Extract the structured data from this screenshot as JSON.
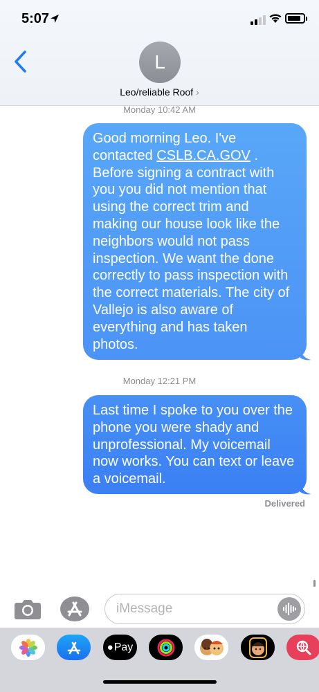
{
  "status_bar": {
    "time": "5:07"
  },
  "header": {
    "avatar_initial": "L",
    "contact_name": "Leo/reliable Roof",
    "chevron": "›"
  },
  "conversation": [
    {
      "timestamp_day": "Monday",
      "timestamp_time": "10:42 AM",
      "text_before_link": "Good morning Leo. I've contacted ",
      "link_text": "CSLB.CA.GOV",
      "text_after_link": " . Before signing a contract with you you did not mention that using the correct trim and making our house look like the neighbors would not pass inspection. We want the  done correctly to pass inspection with the correct materials. The city of Vallejo is also aware of everything and has taken photos."
    },
    {
      "timestamp_day": "Monday",
      "timestamp_time": "12:21 PM",
      "text": "Last time I spoke to you over the phone you were shady and unprofessional. My voicemail now works. You can text or leave a voicemail."
    }
  ],
  "delivery_status": "Delivered",
  "input": {
    "placeholder": "iMessage",
    "value": ""
  },
  "battery_level": 0.85,
  "app_drawer": {
    "apple_pay_label": "Pay",
    "items": [
      "photos-icon",
      "app-store-icon",
      "apple-pay-icon",
      "activity-icon",
      "memoji-stickers-icon",
      "memoji-icon",
      "web-search-icon"
    ]
  },
  "colors": {
    "bubble_top": "#58a7f8",
    "bubble_bottom": "#3b7ff4",
    "ios_blue": "#1f7cf2",
    "secondary_text": "#8e8e93"
  }
}
